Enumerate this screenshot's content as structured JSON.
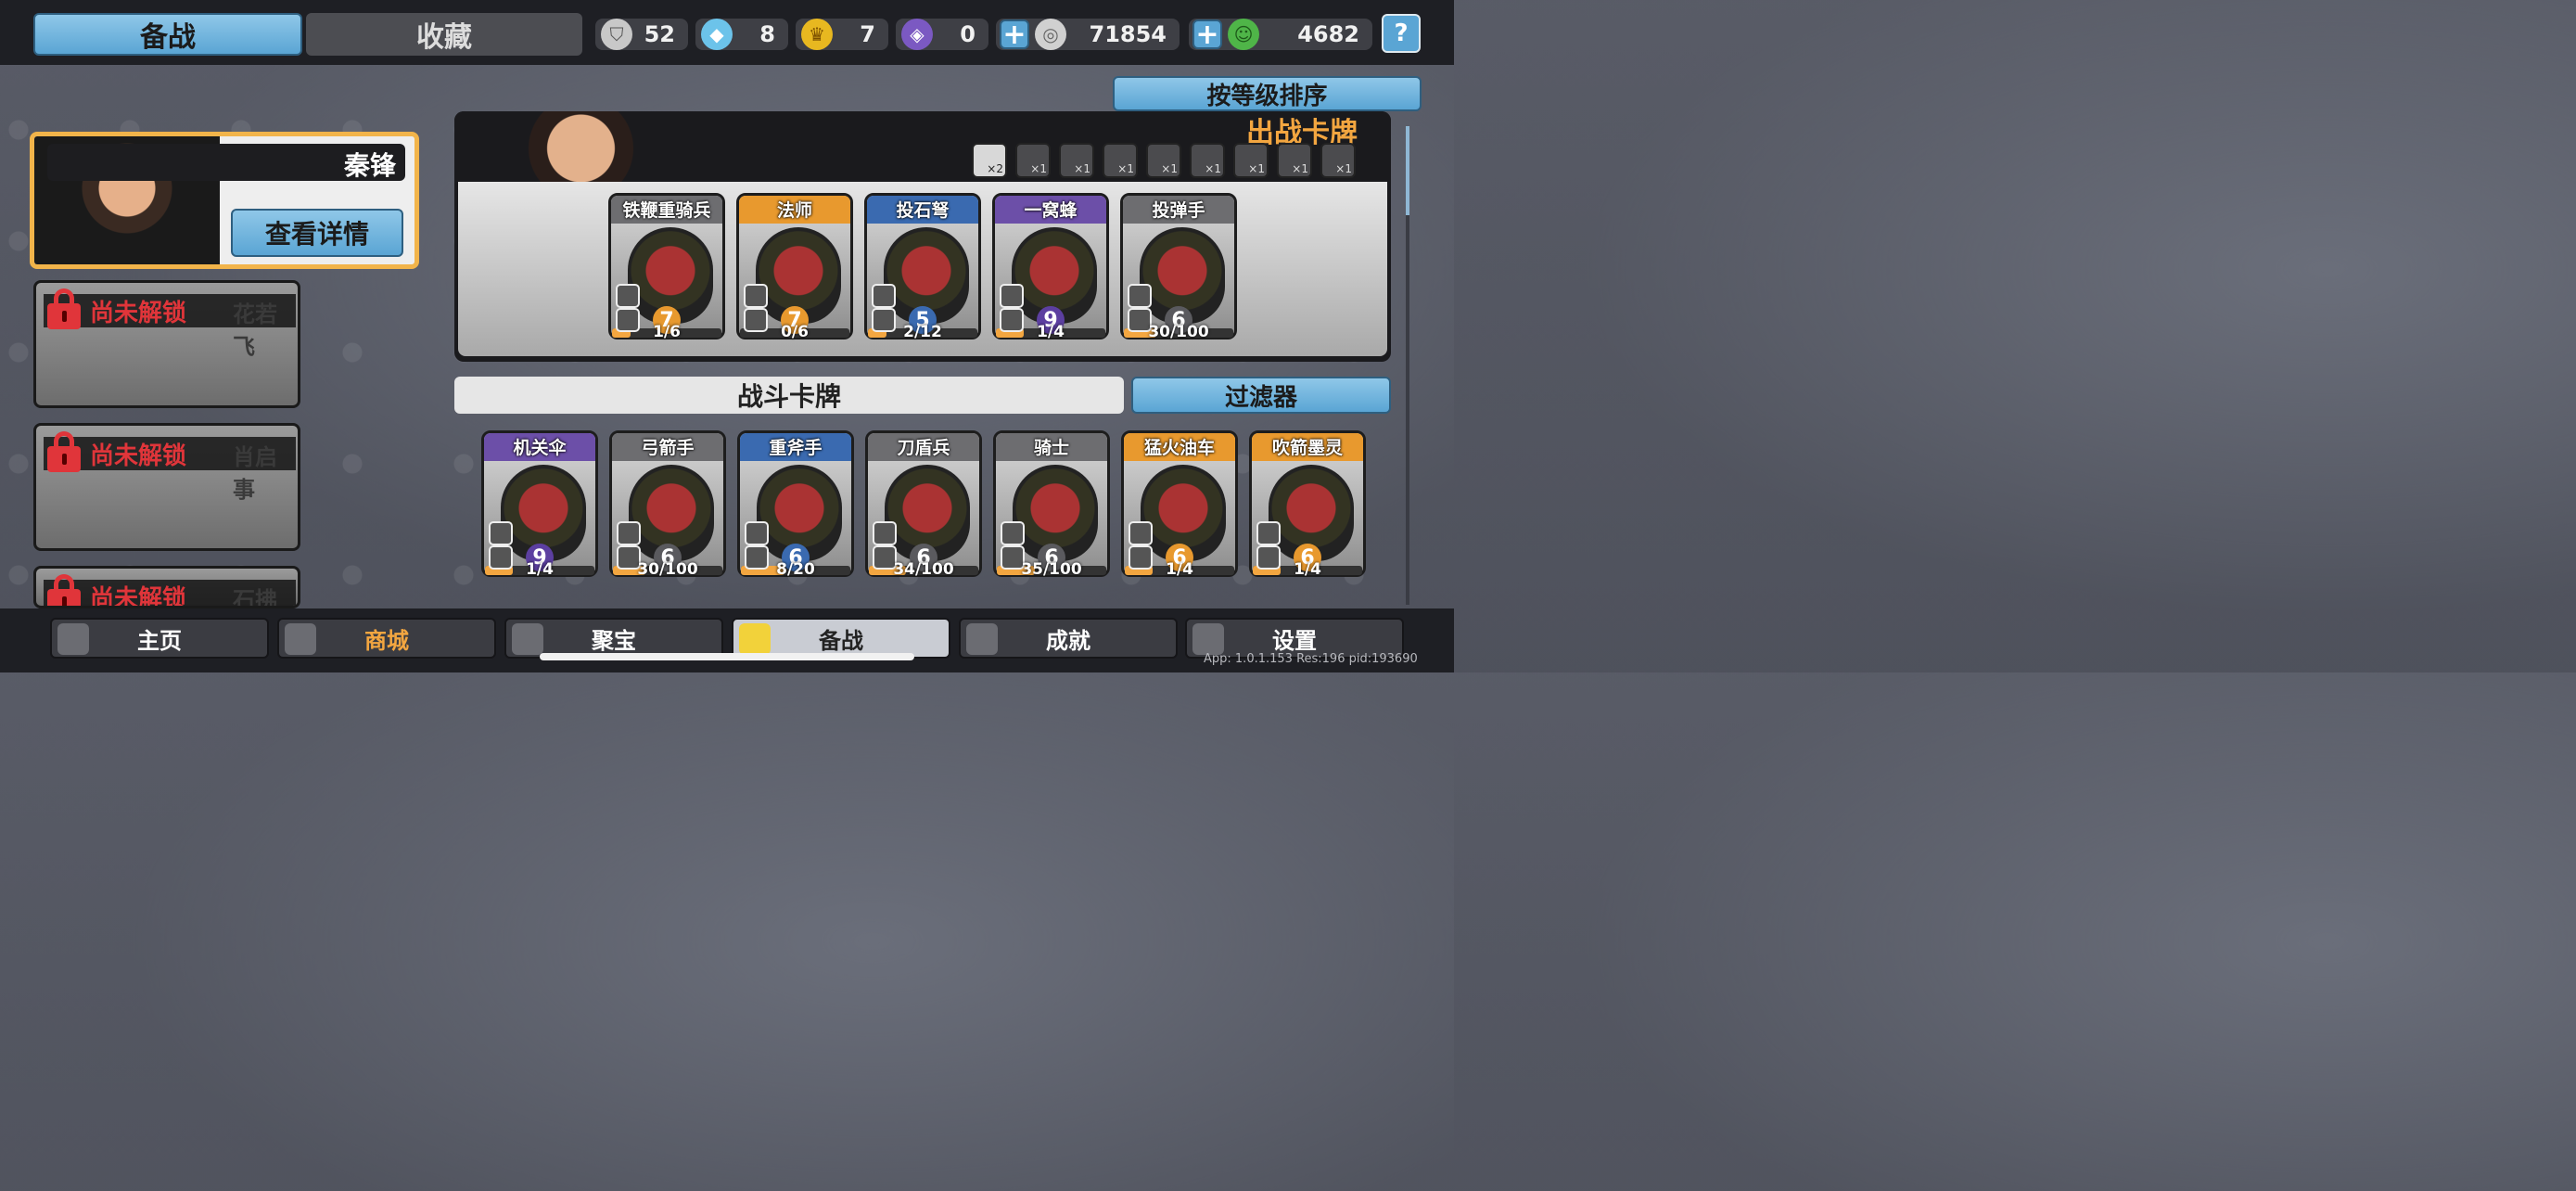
{
  "tabs": {
    "prep": "备战",
    "collect": "收藏"
  },
  "resources": [
    {
      "icon": "silver-shield-icon",
      "value": "52",
      "color": "#c8c8c8"
    },
    {
      "icon": "blue-crystal-icon",
      "value": "8",
      "color": "#6cc3ea"
    },
    {
      "icon": "gold-trophy-icon",
      "value": "7",
      "color": "#e8b820"
    },
    {
      "icon": "purple-gem-icon",
      "value": "0",
      "color": "#7b59c2"
    }
  ],
  "coins": {
    "value": "71854",
    "plus": "+"
  },
  "gems": {
    "value": "4682",
    "plus": "+"
  },
  "help": "?",
  "sort_label": "按等级排序",
  "heroes": {
    "selected": {
      "name": "秦锋",
      "detail": "查看详情"
    },
    "locked": [
      {
        "status": "尚未解锁",
        "name": "花若飞"
      },
      {
        "status": "尚未解锁",
        "name": "肖启事"
      },
      {
        "status": "尚未解锁",
        "name": "石拂衣"
      }
    ]
  },
  "deck": {
    "title": "出战卡牌",
    "traits": [
      "×2",
      "×1",
      "×1",
      "×1",
      "×1",
      "×1",
      "×1",
      "×1",
      "×1"
    ],
    "cards": [
      {
        "name": "铁鞭重骑兵",
        "level": "7",
        "count": "1/6",
        "progress": 0.17,
        "rarity": "grey",
        "lvl": "o"
      },
      {
        "name": "法师",
        "level": "7",
        "count": "0/6",
        "progress": 0.0,
        "rarity": "orange",
        "lvl": "o"
      },
      {
        "name": "投石弩",
        "level": "5",
        "count": "2/12",
        "progress": 0.17,
        "rarity": "blue",
        "lvl": "b"
      },
      {
        "name": "一窝蜂",
        "level": "9",
        "count": "1/4",
        "progress": 0.25,
        "rarity": "purple",
        "lvl": "p"
      },
      {
        "name": "投弹手",
        "level": "6",
        "count": "30/100",
        "progress": 0.3,
        "rarity": "grey",
        "lvl": "g"
      }
    ]
  },
  "battle": {
    "title": "战斗卡牌",
    "filter": "过滤器",
    "cards": [
      {
        "name": "机关伞",
        "level": "9",
        "count": "1/4",
        "progress": 0.25,
        "rarity": "purple",
        "lvl": "p"
      },
      {
        "name": "弓箭手",
        "level": "6",
        "count": "30/100",
        "progress": 0.3,
        "rarity": "grey",
        "lvl": "g"
      },
      {
        "name": "重斧手",
        "level": "6",
        "count": "8/20",
        "progress": 0.4,
        "rarity": "blue",
        "lvl": "b"
      },
      {
        "name": "刀盾兵",
        "level": "6",
        "count": "34/100",
        "progress": 0.34,
        "rarity": "grey",
        "lvl": "g"
      },
      {
        "name": "骑士",
        "level": "6",
        "count": "35/100",
        "progress": 0.35,
        "rarity": "grey",
        "lvl": "g"
      },
      {
        "name": "猛火油车",
        "level": "6",
        "count": "1/4",
        "progress": 0.25,
        "rarity": "orange",
        "lvl": "o"
      },
      {
        "name": "吹箭墨灵",
        "level": "6",
        "count": "1/4",
        "progress": 0.25,
        "rarity": "orange",
        "lvl": "o"
      }
    ]
  },
  "nav": {
    "home": "主页",
    "shop": "商城",
    "treasure": "聚宝",
    "prep": "备战",
    "achieve": "成就",
    "settings": "设置"
  },
  "appinfo": "App: 1.0.1.153 Res:196 pid:193690"
}
